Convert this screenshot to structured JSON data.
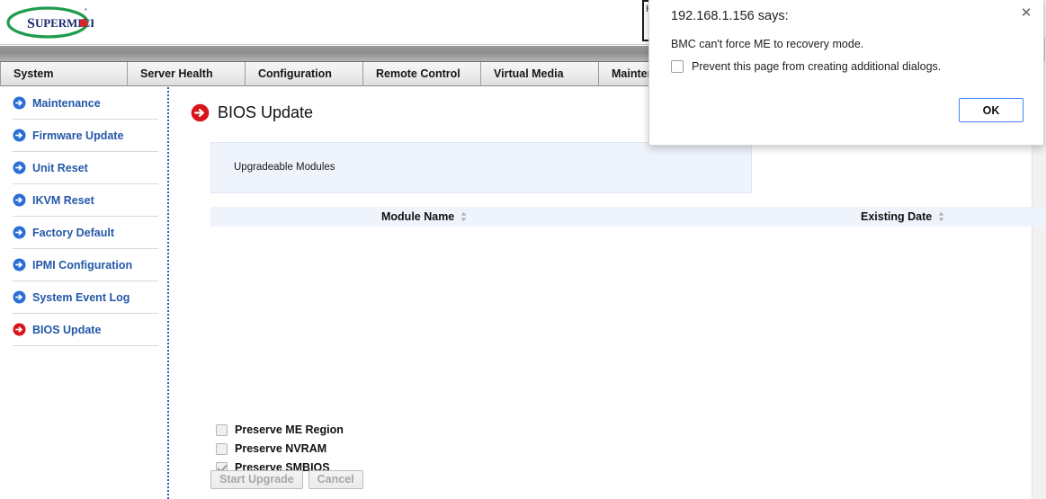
{
  "brand": {
    "logo_text": "SUPERMICRO",
    "logo_name": "supermicro-logo"
  },
  "topnav": {
    "tabs": [
      {
        "label": "System"
      },
      {
        "label": "Server Health"
      },
      {
        "label": "Configuration"
      },
      {
        "label": "Remote Control"
      },
      {
        "label": "Virtual Media"
      },
      {
        "label": "Maintenance"
      }
    ]
  },
  "sidebar": {
    "items": [
      {
        "label": "Maintenance",
        "active": false
      },
      {
        "label": "Firmware Update",
        "active": false
      },
      {
        "label": "Unit Reset",
        "active": false
      },
      {
        "label": "IKVM Reset",
        "active": false
      },
      {
        "label": "Factory Default",
        "active": false
      },
      {
        "label": "IPMI Configuration",
        "active": false
      },
      {
        "label": "System Event Log",
        "active": false
      },
      {
        "label": "BIOS Update",
        "active": true
      }
    ]
  },
  "main": {
    "page_title": "BIOS Update",
    "panel_label": "Upgradeable Modules",
    "table": {
      "columns": [
        {
          "label": "Module Name",
          "sort": "sortable"
        },
        {
          "label": "Existing Date",
          "sort": "sortable"
        }
      ],
      "rows": []
    },
    "options": [
      {
        "label": "Preserve ME Region",
        "checked": false
      },
      {
        "label": "Preserve NVRAM",
        "checked": false
      },
      {
        "label": "Preserve SMBIOS",
        "checked": true
      }
    ],
    "buttons": [
      {
        "label": "Start Upgrade",
        "disabled": true
      },
      {
        "label": "Cancel",
        "disabled": true
      }
    ]
  },
  "dialog": {
    "title": "192.168.1.156 says:",
    "message": "BMC can't force ME to recovery mode.",
    "prevent_label": "Prevent this page from creating additional dialogs.",
    "prevent_checked": false,
    "ok_label": "OK",
    "close_glyph": "✕"
  },
  "colors": {
    "accent_blue": "#2458a8",
    "active_red": "#d7151b",
    "panel_bg": "#eff3fb",
    "dialog_accent": "#4285f4",
    "logo_green": "#1f9c4d",
    "logo_navy": "#1b2a6b",
    "logo_red": "#d9232e"
  },
  "behind": {
    "partial_glyph": "H"
  }
}
